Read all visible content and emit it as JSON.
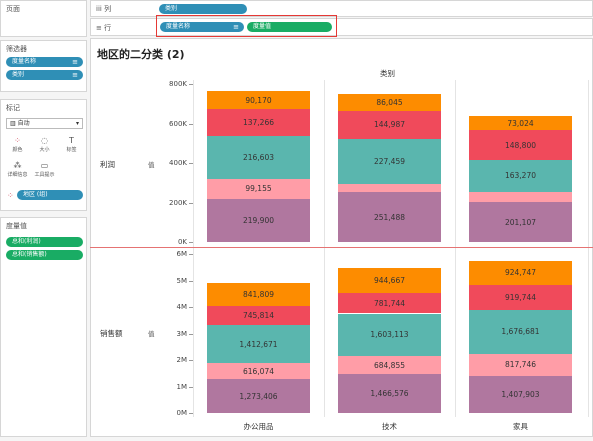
{
  "left": {
    "pages": {
      "title": "页面"
    },
    "filters": {
      "title": "筛选器",
      "items": [
        {
          "label": "度量名称",
          "icon": "filter-icon"
        },
        {
          "label": "类别",
          "icon": "filter-icon"
        }
      ]
    },
    "marks": {
      "title": "标记",
      "type": "自动",
      "buttons": [
        {
          "label": "颜色",
          "icon": "color-icon"
        },
        {
          "label": "大小",
          "icon": "size-icon"
        },
        {
          "label": "标签",
          "icon": "label-icon"
        },
        {
          "label": "详细信息",
          "icon": "detail-icon"
        },
        {
          "label": "工具提示",
          "icon": "tooltip-icon"
        }
      ],
      "field": "地区 (组)"
    },
    "measure_values": {
      "title": "度量值",
      "items": [
        "总和(利润)",
        "总和(销售额)"
      ]
    }
  },
  "shelves": {
    "columns": {
      "label": "列",
      "pills": [
        {
          "text": "类别",
          "color": "blue"
        }
      ]
    },
    "rows": {
      "label": "行",
      "pills": [
        {
          "text": "度量名称",
          "color": "blue"
        },
        {
          "text": "度量值",
          "color": "green"
        }
      ]
    }
  },
  "view": {
    "title": "地区的二分类 (2)",
    "column_header": "类别",
    "row_headers": [
      "利润",
      "销售额"
    ],
    "row_subheader": "值"
  },
  "chart_data": {
    "type": "bar",
    "stacked": true,
    "categories": [
      "办公用品",
      "技术",
      "家具"
    ],
    "panes": [
      {
        "measure": "利润",
        "ylim": [
          0,
          800000
        ],
        "ticks": [
          "0K",
          "200K",
          "400K",
          "600K",
          "800K"
        ],
        "series": [
          {
            "color": "#b0779f",
            "values": [
              219900,
              251488,
              201107
            ],
            "labels": [
              "219,900",
              "251,488",
              "201,107"
            ]
          },
          {
            "color": "#ff9da7",
            "values": [
              99155,
              41000,
              52000
            ],
            "labels": [
              "99,155",
              "",
              ""
            ]
          },
          {
            "color": "#5ab6ae",
            "values": [
              216603,
              227459,
              163270
            ],
            "labels": [
              "216,603",
              "227,459",
              "163,270"
            ]
          },
          {
            "color": "#f04a5b",
            "values": [
              137266,
              144987,
              148800
            ],
            "labels": [
              "137,266",
              "144,987",
              "148,800"
            ]
          },
          {
            "color": "#fd8c00",
            "values": [
              90170,
              86045,
              73024
            ],
            "labels": [
              "90,170",
              "86,045",
              "73,024"
            ]
          }
        ]
      },
      {
        "measure": "销售额",
        "ylim": [
          0,
          6000000
        ],
        "ticks": [
          "0M",
          "1M",
          "2M",
          "3M",
          "4M",
          "5M",
          "6M"
        ],
        "series": [
          {
            "color": "#b0779f",
            "values": [
              1273406,
              1466576,
              1407903
            ],
            "labels": [
              "1,273,406",
              "1,466,576",
              "1,407,903"
            ]
          },
          {
            "color": "#ff9da7",
            "values": [
              616074,
              684855,
              817746
            ],
            "labels": [
              "616,074",
              "684,855",
              "817,746"
            ]
          },
          {
            "color": "#5ab6ae",
            "values": [
              1412671,
              1603113,
              1676681
            ],
            "labels": [
              "1,412,671",
              "1,603,113",
              "1,676,681"
            ]
          },
          {
            "color": "#f04a5b",
            "values": [
              745814,
              781744,
              919744
            ],
            "labels": [
              "745,814",
              "781,744",
              "919,744"
            ]
          },
          {
            "color": "#fd8c00",
            "values": [
              841809,
              944667,
              924747
            ],
            "labels": [
              "841,809",
              "944,667",
              "924,747"
            ]
          }
        ]
      }
    ]
  }
}
